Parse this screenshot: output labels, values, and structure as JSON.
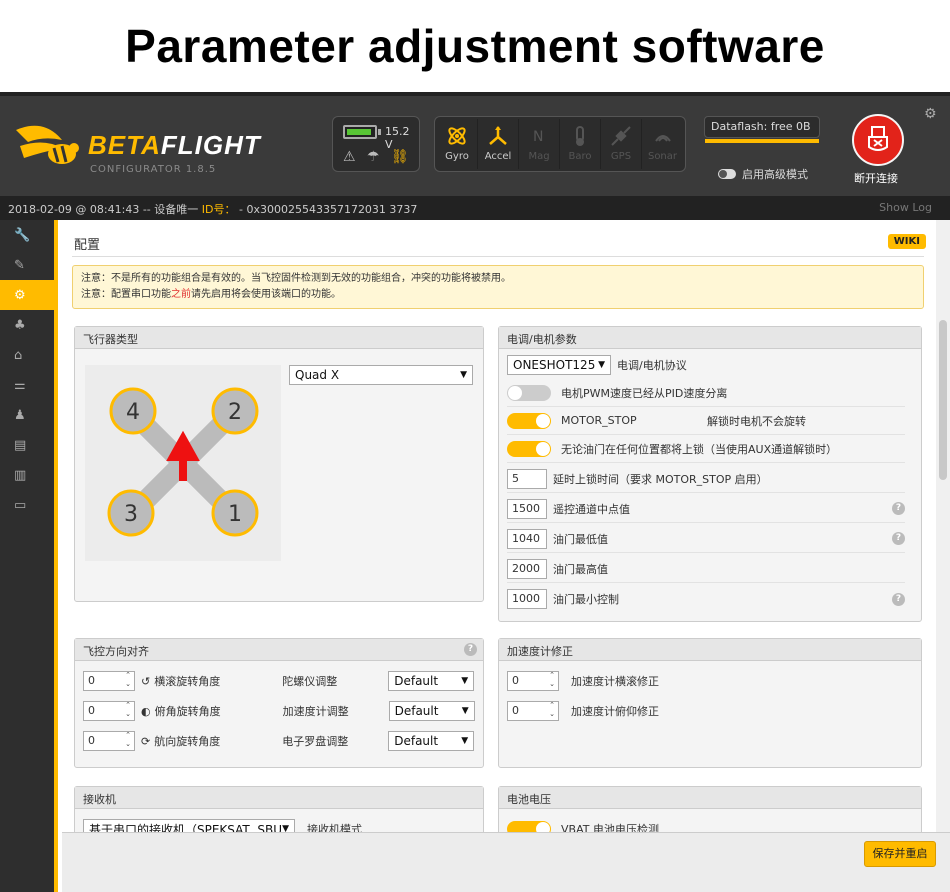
{
  "banner": {
    "title": "Parameter adjustment software"
  },
  "header": {
    "app_name_a": "BETA",
    "app_name_b": "FLIGHT",
    "app_sub": "CONFIGURATOR  1.8.5",
    "voltage": "15.2 V",
    "sensors": [
      {
        "label": "Gyro",
        "active": true
      },
      {
        "label": "Accel",
        "active": true
      },
      {
        "label": "Mag",
        "active": false
      },
      {
        "label": "Baro",
        "active": false
      },
      {
        "label": "GPS",
        "active": false
      },
      {
        "label": "Sonar",
        "active": false
      }
    ],
    "dataflash": "Dataflash: free 0B",
    "expert_mode": "启用高级模式",
    "disconnect": "断开连接"
  },
  "status": {
    "datetime": "2018-02-09 @ 08:41:43 -- 设备唯一",
    "id_label": "ID号：",
    "id_value": "- 0x300025543357172031 3737",
    "show_log": "Show Log"
  },
  "sidebar": {
    "items": [
      {
        "icon": "wrench-icon"
      },
      {
        "icon": "plug-icon"
      },
      {
        "icon": "gear-icon",
        "active": true
      },
      {
        "icon": "ports-icon"
      },
      {
        "icon": "receiver-icon"
      },
      {
        "icon": "modes-icon"
      },
      {
        "icon": "motor-icon"
      },
      {
        "icon": "osd-icon"
      },
      {
        "icon": "blackbox-icon"
      },
      {
        "icon": "cli-icon"
      }
    ]
  },
  "page": {
    "title": "配置",
    "wiki": "WIKI",
    "note_line1": "注意：不是所有的功能组合是有效的。当飞控固件检测到无效的功能组合，冲突的功能将被禁用。",
    "note_line2_a": "注意：配置串口功能",
    "note_line2_hl": "之前",
    "note_line2_b": "请先启用将会使用该端口的功能。"
  },
  "mixer": {
    "title": "飞行器类型",
    "selected": "Quad X",
    "motors": [
      "4",
      "2",
      "3",
      "1"
    ]
  },
  "esc": {
    "title": "电调/电机参数",
    "protocol": "ONESHOT125",
    "protocol_label": "电调/电机协议",
    "toggles": [
      {
        "label": "电机PWM速度已经从PID速度分离",
        "on": false,
        "extra": ""
      },
      {
        "label": "MOTOR_STOP",
        "on": true,
        "extra": "解锁时电机不会旋转"
      },
      {
        "label": "无论油门在任何位置都将上锁（当使用AUX通道解锁时）",
        "on": true,
        "extra": ""
      }
    ],
    "fields": [
      {
        "value": "5",
        "label": "延时上锁时间（要求 MOTOR_STOP 启用）",
        "help": false
      },
      {
        "value": "1500",
        "label": "遥控通道中点值",
        "help": true
      },
      {
        "value": "1040",
        "label": "油门最低值",
        "help": true
      },
      {
        "value": "2000",
        "label": "油门最高值",
        "help": false
      },
      {
        "value": "1000",
        "label": "油门最小控制",
        "help": true
      }
    ]
  },
  "board": {
    "title": "飞控方向对齐",
    "rows": [
      {
        "value": "0",
        "label": "横滚旋转角度",
        "sensor": "陀螺仪调整",
        "select": "Default"
      },
      {
        "value": "0",
        "label": "俯角旋转角度",
        "sensor": "加速度计调整",
        "select": "Default"
      },
      {
        "value": "0",
        "label": "航向旋转角度",
        "sensor": "电子罗盘调整",
        "select": "Default"
      }
    ]
  },
  "acc": {
    "title": "加速度计修正",
    "rows": [
      {
        "value": "0",
        "label": "加速度计横滚修正"
      },
      {
        "value": "0",
        "label": "加速度计俯仰修正"
      }
    ]
  },
  "receiver": {
    "title": "接收机",
    "select": "基于串口的接收机（SPEKSAT, SBU",
    "label": "接收机模式"
  },
  "battery": {
    "title": "电池电压",
    "label": "VBAT 电池电压检测"
  },
  "footer": {
    "save": "保存并重启"
  }
}
